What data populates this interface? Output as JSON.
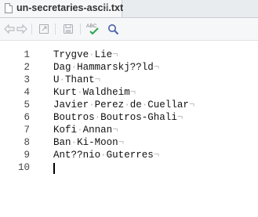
{
  "tab": {
    "filename": "un-secretaries-ascii.txt",
    "close_glyph": "×"
  },
  "toolbar": {
    "icons": [
      "back-arrow-icon",
      "forward-arrow-icon",
      "show-in-window-icon",
      "save-icon",
      "spellcheck-icon",
      "search-icon"
    ],
    "spellcheck_text": "ABC"
  },
  "editor": {
    "lines": [
      {
        "number": "1",
        "text": "Trygve·Lie¬"
      },
      {
        "number": "2",
        "text": "Dag·Hammarskj??ld¬"
      },
      {
        "number": "3",
        "text": "U·Thant¬"
      },
      {
        "number": "4",
        "text": "Kurt·Waldheim¬"
      },
      {
        "number": "5",
        "text": "Javier·Perez·de·Cuellar¬"
      },
      {
        "number": "6",
        "text": "Boutros·Boutros-Ghali¬"
      },
      {
        "number": "7",
        "text": "Kofi·Annan¬"
      },
      {
        "number": "8",
        "text": "Ban·Ki-Moon¬"
      },
      {
        "number": "9",
        "text": "Ant??nio·Guterres¬"
      },
      {
        "number": "10",
        "text": ""
      }
    ]
  }
}
